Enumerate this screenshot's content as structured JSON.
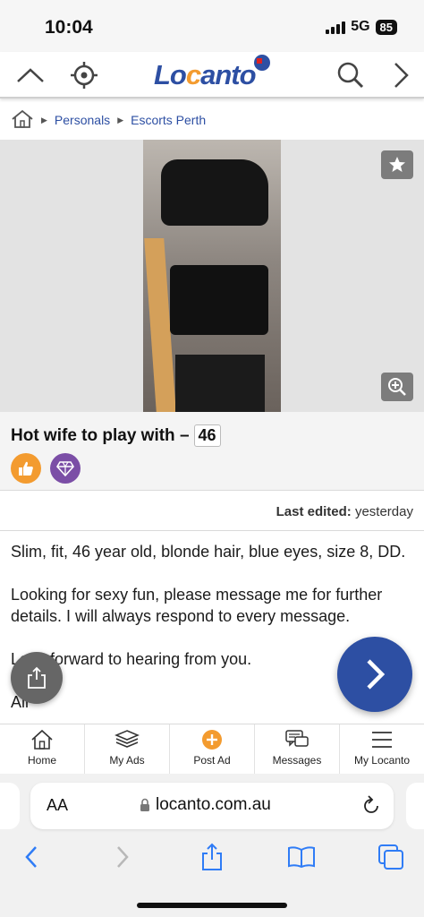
{
  "status_bar": {
    "time": "10:04",
    "network": "5G",
    "battery": "85"
  },
  "header": {
    "logo_text_lo": "Lo",
    "logo_text_c": "c",
    "logo_text_rest": "anto"
  },
  "breadcrumb": {
    "items": [
      "Personals",
      "Escorts Perth"
    ]
  },
  "ad": {
    "title": "Hot wife to play with –",
    "age": "46",
    "last_edited_label": "Last edited:",
    "last_edited_value": "yesterday",
    "description": [
      "Slim, fit, 46 year old, blonde hair, blue eyes, size 8, DD.",
      "Looking for sexy fun, please message me for further details. I will always respond to every message.",
      "Look forward to hearing from you.",
      "Ali"
    ]
  },
  "bottom_nav": {
    "items": [
      {
        "label": "Home",
        "icon": "home-icon"
      },
      {
        "label": "My Ads",
        "icon": "stack-icon"
      },
      {
        "label": "Post Ad",
        "icon": "plus-circle-icon"
      },
      {
        "label": "Messages",
        "icon": "chat-icon"
      },
      {
        "label": "My Locanto",
        "icon": "menu-icon"
      }
    ]
  },
  "browser": {
    "text_size_label": "AA",
    "url": "locanto.com.au"
  },
  "colors": {
    "brand_blue": "#2d4fa3",
    "brand_orange": "#f39b2f",
    "badge_purple": "#7b4ea6"
  }
}
